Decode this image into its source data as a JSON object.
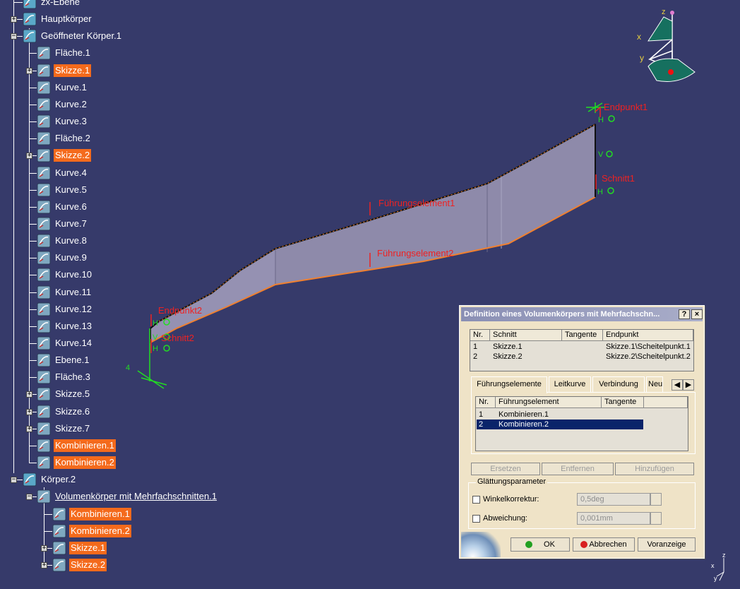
{
  "tree": {
    "items": [
      {
        "label": "zx-Ebene",
        "level": 1
      },
      {
        "label": "Hauptkörper",
        "level": 1
      },
      {
        "label": "Geöffneter Körper.1",
        "level": 1
      },
      {
        "label": "Fläche.1",
        "level": 2
      },
      {
        "label": "Skizze.1",
        "level": 2,
        "highlighted": true
      },
      {
        "label": "Kurve.1",
        "level": 2
      },
      {
        "label": "Kurve.2",
        "level": 2
      },
      {
        "label": "Kurve.3",
        "level": 2
      },
      {
        "label": "Fläche.2",
        "level": 2
      },
      {
        "label": "Skizze.2",
        "level": 2,
        "highlighted": true
      },
      {
        "label": "Kurve.4",
        "level": 2
      },
      {
        "label": "Kurve.5",
        "level": 2
      },
      {
        "label": "Kurve.6",
        "level": 2
      },
      {
        "label": "Kurve.7",
        "level": 2
      },
      {
        "label": "Kurve.8",
        "level": 2
      },
      {
        "label": "Kurve.9",
        "level": 2
      },
      {
        "label": "Kurve.10",
        "level": 2
      },
      {
        "label": "Kurve.11",
        "level": 2
      },
      {
        "label": "Kurve.12",
        "level": 2
      },
      {
        "label": "Kurve.13",
        "level": 2
      },
      {
        "label": "Kurve.14",
        "level": 2
      },
      {
        "label": "Ebene.1",
        "level": 2
      },
      {
        "label": "Fläche.3",
        "level": 2
      },
      {
        "label": "Skizze.5",
        "level": 2
      },
      {
        "label": "Skizze.6",
        "level": 2
      },
      {
        "label": "Skizze.7",
        "level": 2
      },
      {
        "label": "Kombinieren.1",
        "level": 2,
        "highlighted": true
      },
      {
        "label": "Kombinieren.2",
        "level": 2,
        "highlighted": true
      },
      {
        "label": "Körper.2",
        "level": 1
      },
      {
        "label": "Volumenkörper mit Mehrfachschnitten.1",
        "level": 2,
        "underlined": true
      },
      {
        "label": "Kombinieren.1",
        "level": 3,
        "highlighted": true
      },
      {
        "label": "Kombinieren.2",
        "level": 3,
        "highlighted": true
      },
      {
        "label": "Skizze.1",
        "level": 3,
        "highlighted": true
      },
      {
        "label": "Skizze.2",
        "level": 3,
        "highlighted": true
      }
    ]
  },
  "viewport": {
    "labels": {
      "endpunkt1": "Endpunkt1",
      "schnitt1": "Schnitt1",
      "fuehrung1": "Führungselement1",
      "fuehrung2": "Führungselement2",
      "endpunkt2": "Endpunkt2",
      "schnitt2": "Schnitt2"
    },
    "compass": {
      "x": "x",
      "y": "y",
      "z": "z"
    },
    "mini_axes": {
      "x": "x",
      "y": "y",
      "z": "z"
    }
  },
  "dialog": {
    "title": "Definition eines Volumenkörpers mit Mehrfachschn...",
    "help_label": "?",
    "close_label": "×",
    "sections_table": {
      "headers": [
        "Nr.",
        "Schnitt",
        "Tangente",
        "Endpunkt"
      ],
      "rows": [
        [
          "1",
          "Skizze.1",
          "",
          "Skizze.1\\Scheitelpunkt.1"
        ],
        [
          "2",
          "Skizze.2",
          "",
          "Skizze.2\\Scheitelpunkt.2"
        ]
      ]
    },
    "tabs": [
      "Führungselemente",
      "Leitkurve",
      "Verbindung",
      "Neu"
    ],
    "active_tab": 0,
    "guides_table": {
      "headers": [
        "Nr.",
        "Führungselement",
        "Tangente"
      ],
      "rows": [
        [
          "1",
          "Kombinieren.1",
          ""
        ],
        [
          "2",
          "Kombinieren.2",
          ""
        ]
      ],
      "selected_row": 1
    },
    "buttons": {
      "replace": "Ersetzen",
      "remove": "Entfernen",
      "add": "Hinzufügen"
    },
    "smoothing": {
      "legend": "Glättungsparameter",
      "angle_label": "Winkelkorrektur:",
      "angle_value": "0,5deg",
      "deviation_label": "Abweichung:",
      "deviation_value": "0,001mm"
    },
    "footer": {
      "ok": "OK",
      "cancel": "Abbrechen",
      "preview": "Voranzeige"
    }
  },
  "colors": {
    "background": "#363a6a",
    "highlight": "#f46a1c",
    "selection": "#0a246a",
    "annotation": "#ee2222",
    "dialog": "#efe3c7"
  }
}
